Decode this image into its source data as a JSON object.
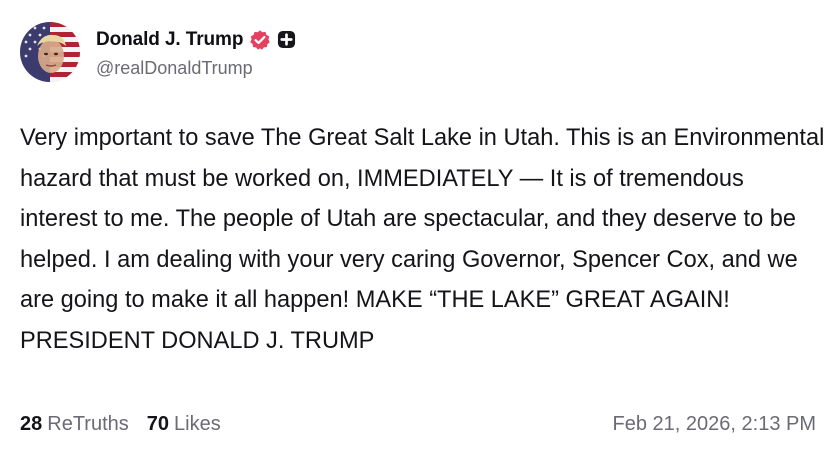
{
  "author": {
    "display_name": "Donald J. Trump",
    "handle": "@realDonaldTrump",
    "avatar_icon": "user-avatar-flag",
    "verified_icon": "verified-badge-icon",
    "verified_color": "#e4405f",
    "plus_icon": "plus-badge-icon"
  },
  "post": {
    "text": "Very important to save The Great Salt Lake in Utah. This is an Environmental hazard that must be worked on, IMMEDIATELY — It is of tremendous interest to me. The people of Utah are spectacular, and they deserve to be helped. I am dealing with your very caring Governor, Spencer Cox, and we are going to make it all happen! MAKE “THE LAKE” GREAT AGAIN! PRESIDENT DONALD J. TRUMP"
  },
  "stats": {
    "retruths_count": "28",
    "retruths_label": "ReTruths",
    "likes_count": "70",
    "likes_label": "Likes"
  },
  "timestamp": "Feb 21, 2026, 2:13 PM"
}
